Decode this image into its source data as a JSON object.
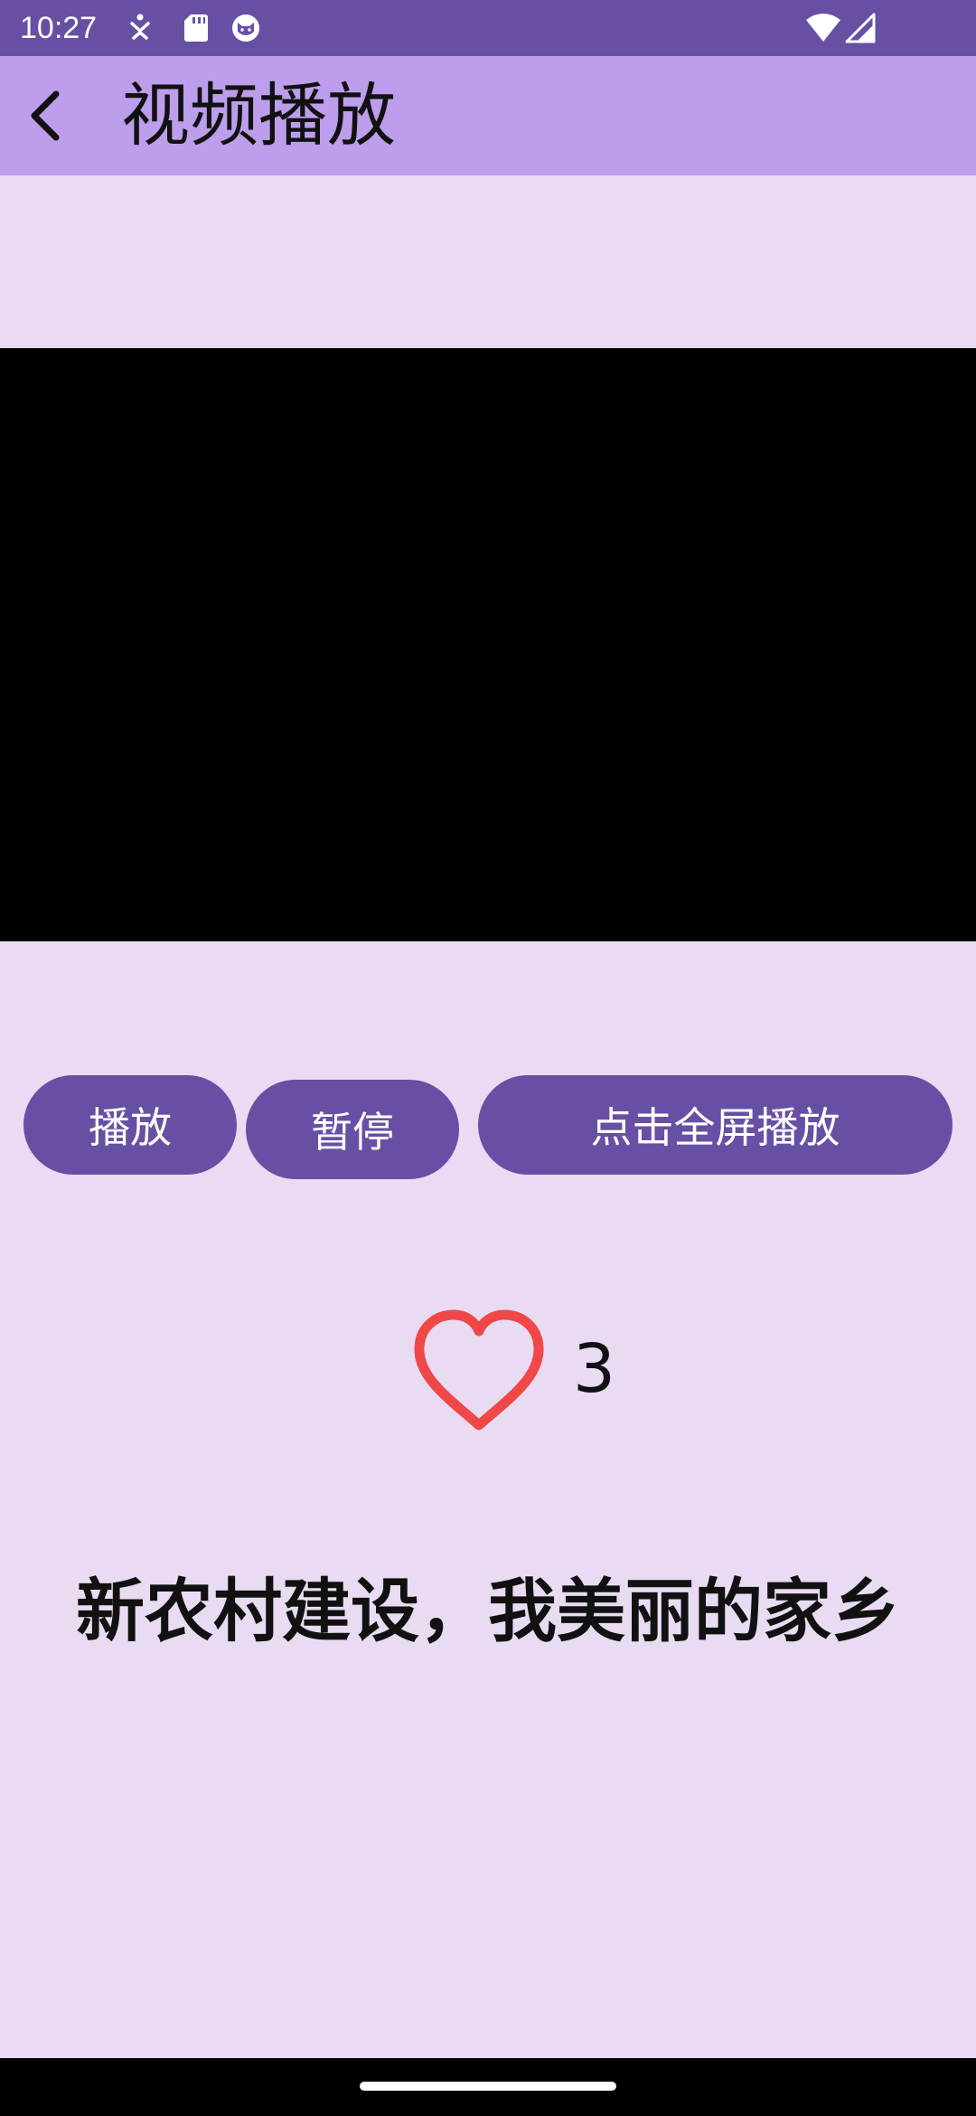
{
  "status_bar": {
    "time": "10:27",
    "left_icons": [
      "accessibility-icon",
      "sd-card-icon",
      "cat-face-icon"
    ],
    "right_icons": [
      "wifi-icon",
      "cellular-signal-icon"
    ]
  },
  "app_bar": {
    "back_icon": "arrow-back-icon",
    "title": "视频播放"
  },
  "video_player": {
    "background": "#000000"
  },
  "controls": {
    "play_label": "播放",
    "pause_label": "暂停",
    "fullscreen_label": "点击全屏播放"
  },
  "likes": {
    "icon": "heart-outline-icon",
    "count": "3"
  },
  "caption": "新农村建设，我美丽的家乡",
  "colors": {
    "status_bar": "#6750A4",
    "app_bar": "#BD9EEC",
    "background": "#E8DBF2",
    "button": "#6750A4",
    "heart": "#F04848"
  }
}
